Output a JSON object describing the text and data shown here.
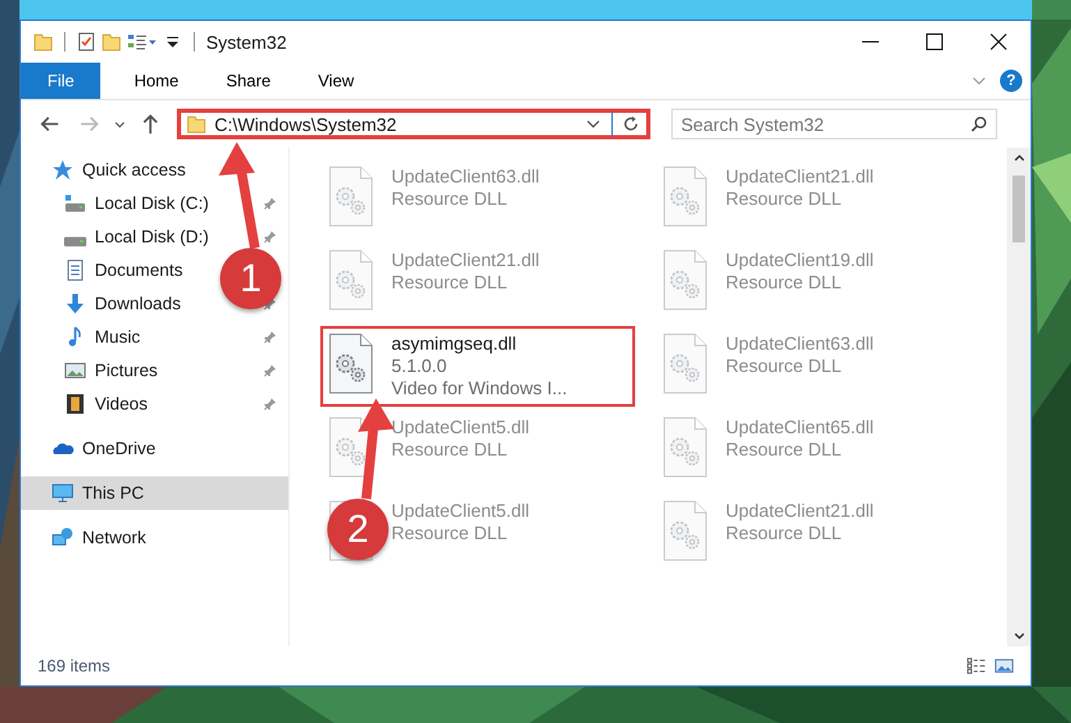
{
  "window": {
    "title": "System32"
  },
  "ribbon_tabs": [
    {
      "label": "File",
      "kind": "file"
    },
    {
      "label": "Home",
      "kind": "tab"
    },
    {
      "label": "Share",
      "kind": "tab"
    },
    {
      "label": "View",
      "kind": "tab"
    }
  ],
  "help": {
    "label": "?"
  },
  "address_bar": {
    "path": "C:\\Windows\\System32",
    "highlighted": true
  },
  "search": {
    "placeholder": "Search System32"
  },
  "sidebar": {
    "items": [
      {
        "label": "Quick access",
        "kind": "star",
        "selected": false,
        "children": [
          {
            "label": "Local Disk (C:)",
            "kind": "drive-win",
            "pinned": true,
            "selected": false
          },
          {
            "label": "Local Disk (D:)",
            "kind": "drive",
            "pinned": true,
            "selected": false
          },
          {
            "label": "Documents",
            "kind": "documents",
            "selected": false
          },
          {
            "label": "Downloads",
            "kind": "downloads",
            "pinned": true,
            "selected": false
          },
          {
            "label": "Music",
            "kind": "music",
            "pinned": true,
            "selected": false
          },
          {
            "label": "Pictures",
            "kind": "pictures",
            "pinned": true,
            "selected": false
          },
          {
            "label": "Videos",
            "kind": "videos",
            "pinned": true,
            "selected": false
          }
        ]
      },
      {
        "label": "OneDrive",
        "kind": "cloud",
        "selected": false
      },
      {
        "label": "This PC",
        "kind": "pc",
        "selected": true
      },
      {
        "label": "Network",
        "kind": "network",
        "selected": false
      }
    ]
  },
  "files": [
    {
      "name": "UpdateClient63.dll",
      "details": [
        "Resource DLL"
      ],
      "blurred": true,
      "highlighted": false
    },
    {
      "name": "UpdateClient21.dll",
      "details": [
        "Resource DLL"
      ],
      "blurred": true,
      "highlighted": false
    },
    {
      "name": "UpdateClient21.dll",
      "details": [
        "Resource DLL"
      ],
      "blurred": true,
      "highlighted": false
    },
    {
      "name": "UpdateClient19.dll",
      "details": [
        "Resource DLL"
      ],
      "blurred": true,
      "highlighted": false
    },
    {
      "name": "asymimgseq.dll",
      "details": [
        "5.1.0.0",
        "Video for Windows I..."
      ],
      "blurred": false,
      "highlighted": true
    },
    {
      "name": "UpdateClient63.dll",
      "details": [
        "Resource DLL"
      ],
      "blurred": true,
      "highlighted": false
    },
    {
      "name": "UpdateClient5.dll",
      "details": [
        "Resource DLL"
      ],
      "blurred": true,
      "highlighted": false
    },
    {
      "name": "UpdateClient65.dll",
      "details": [
        "Resource DLL"
      ],
      "blurred": true,
      "highlighted": false
    },
    {
      "name": "UpdateClient5.dll",
      "details": [
        "Resource DLL"
      ],
      "blurred": true,
      "highlighted": false
    },
    {
      "name": "UpdateClient21.dll",
      "details": [
        "Resource DLL"
      ],
      "blurred": true,
      "highlighted": false
    }
  ],
  "annotations": [
    {
      "number": "1"
    },
    {
      "number": "2"
    }
  ],
  "status_bar": {
    "item_count": "169 items"
  }
}
